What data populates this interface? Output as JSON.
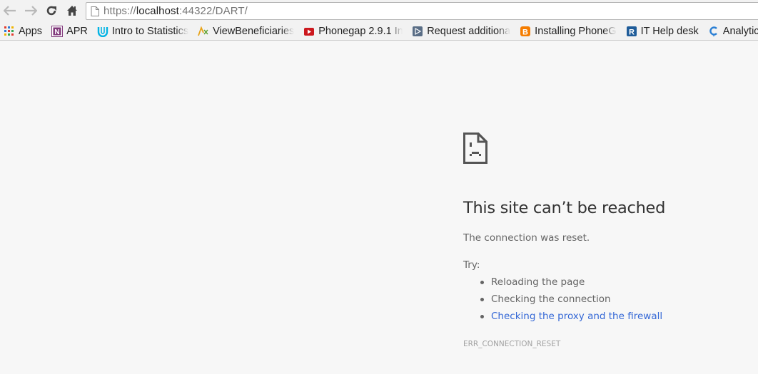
{
  "browser": {
    "nav": {
      "back_icon": "back-arrow-icon",
      "forward_icon": "forward-arrow-icon",
      "reload_icon": "reload-icon",
      "home_icon": "home-icon"
    },
    "omnibox": {
      "scheme": "https://",
      "host": "localhost",
      "rest": ":44322/DART/",
      "icon": "page-icon"
    },
    "bookmarks": [
      {
        "label": "Apps",
        "icon": "apps-grid-icon",
        "color": "#e33b2e"
      },
      {
        "label": "APR",
        "icon": "onenote-icon",
        "color": "#80397b"
      },
      {
        "label": "Intro to Statistics",
        "icon": "udacity-icon",
        "color": "#02b3e4"
      },
      {
        "label": "ViewBeneficiaries",
        "icon": "people-icon",
        "color": "#e8a317"
      },
      {
        "label": "Phonegap 2.9.1 In",
        "icon": "youtube-icon",
        "color": "#cc181e"
      },
      {
        "label": "Request additiona",
        "icon": "play-box-icon",
        "color": "#5a6e86"
      },
      {
        "label": "Installing PhoneG",
        "icon": "blogger-icon",
        "color": "#f57d00"
      },
      {
        "label": "IT Help desk",
        "icon": "r-logo-icon",
        "color": "#1f5c99"
      },
      {
        "label": "Analytics",
        "icon": "c-logo-icon",
        "color": "#2a7fd4"
      }
    ]
  },
  "error_page": {
    "icon": "sad-page-icon",
    "title": "This site can’t be reached",
    "subtitle": "The connection was reset.",
    "try_label": "Try:",
    "suggestions": [
      {
        "text": "Reloading the page",
        "link": false
      },
      {
        "text": "Checking the connection",
        "link": false
      },
      {
        "text": "Checking the proxy and the firewall",
        "link": true
      }
    ],
    "error_code": "ERR_CONNECTION_RESET"
  }
}
